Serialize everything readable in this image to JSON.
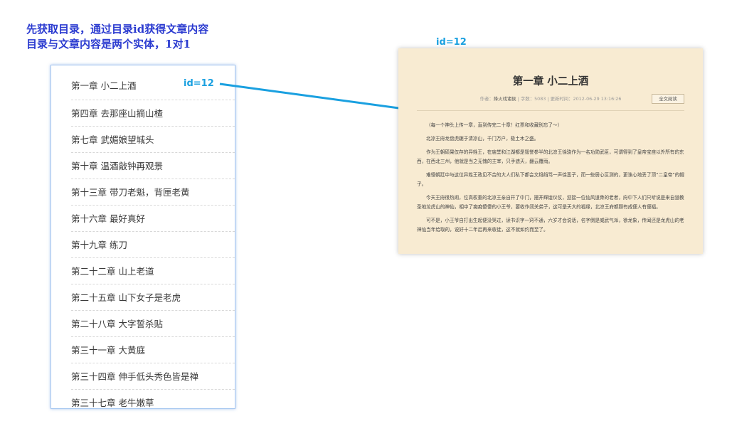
{
  "heading": {
    "line1": "先获取目录，通过目录id获得文章内容",
    "line2": "目录与文章内容是两个实体，1对1"
  },
  "toc": {
    "items": [
      "第一章 小二上酒",
      "第四章 去那座山摘山楂",
      "第七章 武媚娘望城头",
      "第十章 温酒敲钟再观景",
      "第十三章 带刀老魁，背匣老黄",
      "第十六章 最好真好",
      "第十九章 练刀",
      "第二十二章 山上老道",
      "第二十五章 山下女子是老虎",
      "第二十八章 大字誓杀贴",
      "第三十一章 大黄庭",
      "第三十四章 伸手低头秀色皆是禅",
      "第三十七章 老牛嫩草"
    ]
  },
  "labels": {
    "toc_id": "id=12",
    "article_id": "id=12"
  },
  "article": {
    "title": "第一章 小二上酒",
    "author_label": "作者：",
    "author": "烽火戏诸侯",
    "word_count": "字数：5083",
    "updated": "更新时间：2012-06-29 13:16:26",
    "read_button": "全文阅读",
    "paragraphs": [
      "（每一个神头上传一章，直到传完二十章！红票和收藏别忘了～）",
      "北凉王府龙盘虎踞于清凉山，千门万户，极土木之盛。",
      "作为王朝硕果仅存的异姓王，在庙堂和江湖都是毁誉参半的北凉王徐骁作为一名功勋武臣，可谓得到了皇帝宝座以外所有的东西，在西北三州，他就是当之无愧的主宰，只手遮天，翻云覆雨。",
      "难怪朝廷中与这位异姓王政见不合的大人们私下都会文绉绉骂一声徐蛮子，而一些居心叵测的，更诛心地丢了顶“二皇帝”的帽子。",
      "今天王府很热闹，位高权重的北凉王亲自开了中门，摆开辉煌仪仗，迎接一位仙风道骨的老者，府中下人们只听说是来自道教圣地龙虎山的神仙，相中了痴痴傻傻的小王爷，要收作闭关弟子，这可是天大的福缘，北凉王府都颇有成便人有便福。",
      "可不是，小王爷自打出生起便没哭过，读书识字一窍不通，六岁才会说话，名字倒是威武气派，徐龙象，传闻还是龙虎山的老神仙当年给取的，说好十二年后再来收徒，这不就如约而至了。"
    ]
  },
  "colors": {
    "heading": "#2b3bd0",
    "id_label": "#1aa0e0",
    "arrow": "#1aa0e0",
    "article_bg": "#f8ebd2",
    "toc_border": "#a8c8f0"
  }
}
